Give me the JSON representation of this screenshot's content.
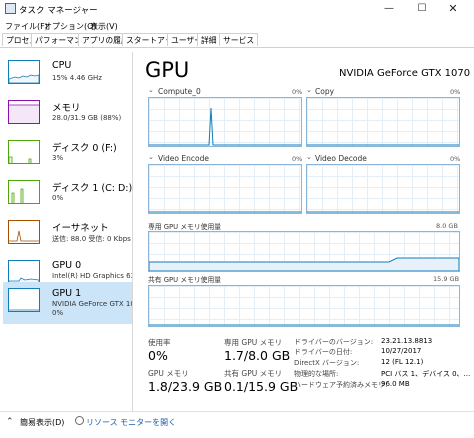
{
  "window": {
    "title": "タスク マネージャー",
    "controls": {
      "minimize": "—",
      "maximize": "☐",
      "close": "✕"
    }
  },
  "menu": [
    "ファイル(F)",
    "オプション(O)",
    "表示(V)"
  ],
  "tabs": [
    {
      "label": "プロセス",
      "active": false
    },
    {
      "label": "パフォーマンス",
      "active": true
    },
    {
      "label": "アプリの履歴",
      "active": false
    },
    {
      "label": "スタートアップ",
      "active": false
    },
    {
      "label": "ユーザー",
      "active": false
    },
    {
      "label": "詳細",
      "active": false
    },
    {
      "label": "サービス",
      "active": false
    }
  ],
  "sidebar": {
    "items": [
      {
        "name": "CPU",
        "line1": "15%  4.46 GHz",
        "line2": "",
        "color": "#117dbb"
      },
      {
        "name": "メモリ",
        "line1": "28.0/31.9 GB (88%)",
        "line2": "",
        "color": "#8b12ae"
      },
      {
        "name": "ディスク 0 (F:)",
        "line1": "3%",
        "line2": "",
        "color": "#4da60c"
      },
      {
        "name": "ディスク 1 (C: D:)",
        "line1": "0%",
        "line2": "",
        "color": "#4da60c"
      },
      {
        "name": "イーサネット",
        "line1": "送信: 88.0  受信: 0 Kbps",
        "line2": "",
        "color": "#a74f01"
      },
      {
        "name": "GPU 0",
        "line1": "Intel(R) HD Graphics 630",
        "line2": "4%",
        "color": "#117dbb"
      },
      {
        "name": "GPU 1",
        "line1": "NVIDIA GeForce GTX 1070",
        "line2": "0%",
        "color": "#117dbb",
        "selected": true
      }
    ]
  },
  "main": {
    "title": "GPU",
    "model": "NVIDIA GeForce GTX 1070",
    "graphs": [
      {
        "label": "Compute_0",
        "pct": "0%"
      },
      {
        "label": "Copy",
        "pct": "0%"
      },
      {
        "label": "Video Encode",
        "pct": "0%"
      },
      {
        "label": "Video Decode",
        "pct": "0%"
      }
    ],
    "dedicated_graph": {
      "label": "専用 GPU メモリ使用量",
      "max": "8.0 GB"
    },
    "shared_graph": {
      "label": "共有 GPU メモリ使用量",
      "max": "15.9 GB"
    },
    "stats": {
      "utilization_label": "使用率",
      "utilization_value": "0%",
      "dedicated_label": "専用 GPU メモリ",
      "dedicated_value": "1.7/8.0 GB",
      "gpu_memory_label": "GPU メモリ",
      "gpu_memory_value": "1.8/23.9 GB",
      "shared_label": "共有 GPU メモリ",
      "shared_value": "0.1/15.9 GB"
    },
    "info": [
      {
        "label": "ドライバーのバージョン:",
        "value": "23.21.13.8813"
      },
      {
        "label": "ドライバーの日付:",
        "value": "10/27/2017"
      },
      {
        "label": "DirectX バージョン:",
        "value": "12 (FL 12.1)"
      },
      {
        "label": "物理的な場所:",
        "value": "PCI バス 1、デバイス 0、..."
      },
      {
        "label": "ハードウェア予約済みメモリ:",
        "value": "96.0 MB"
      }
    ]
  },
  "footer": {
    "fewer_details": "簡易表示(D)",
    "resource_monitor": "リソース モニターを開く"
  }
}
